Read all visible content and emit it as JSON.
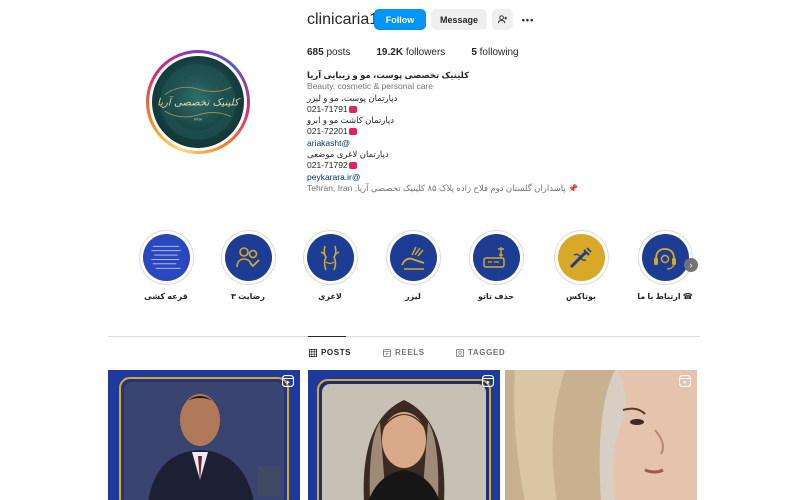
{
  "profile": {
    "username": "clinicaria1",
    "follow_label": "Follow",
    "message_label": "Message",
    "more_label": "•••",
    "stats": {
      "posts_count": "685",
      "posts_label": "posts",
      "followers_count": "19.2K",
      "followers_label": "followers",
      "following_count": "5",
      "following_label": "following"
    },
    "avatar_text": "کلینیک تخصصی آریا",
    "bio": {
      "title": "کلینیک تخصصی پوست، مو و زیبایی آریا",
      "category": "Beauty, cosmetic & personal care",
      "line1": "دپارتمان پوست، مو و لیزر",
      "phone1": "021-71791",
      "line2": "دپارتمان کاشت مو و ابرو",
      "phone2": "021-72201",
      "handle1": "ariakasht@",
      "line3": "دپارتمان لاغری موضعی",
      "phone3": "021-71792",
      "handle2": "peykarara.ir@",
      "address": "Tehran, Iran ,پاسداران گلستان دوم فلاح زاده پلاک ۸۵ کلینیک تخصصی آریا"
    }
  },
  "highlights": [
    {
      "label": "قرعه کشی",
      "icon": "lottery-icon"
    },
    {
      "label": "رضایت ۳",
      "icon": "satisfaction-icon"
    },
    {
      "label": "لاغری",
      "icon": "body-slimming-icon"
    },
    {
      "label": "لیزر",
      "icon": "laser-icon"
    },
    {
      "label": "حذف تاتو",
      "icon": "tattoo-removal-icon"
    },
    {
      "label": "بوتاکس",
      "icon": "botox-icon"
    },
    {
      "label": "ارتباط با ما ☎",
      "icon": "contact-headset-icon"
    }
  ],
  "tabs": {
    "posts": "POSTS",
    "reels": "REELS",
    "tagged": "TAGGED"
  },
  "colors": {
    "follow_blue": "#0095f6",
    "highlight_navy": "#1d3c94",
    "highlight_gold": "#d8a926"
  }
}
